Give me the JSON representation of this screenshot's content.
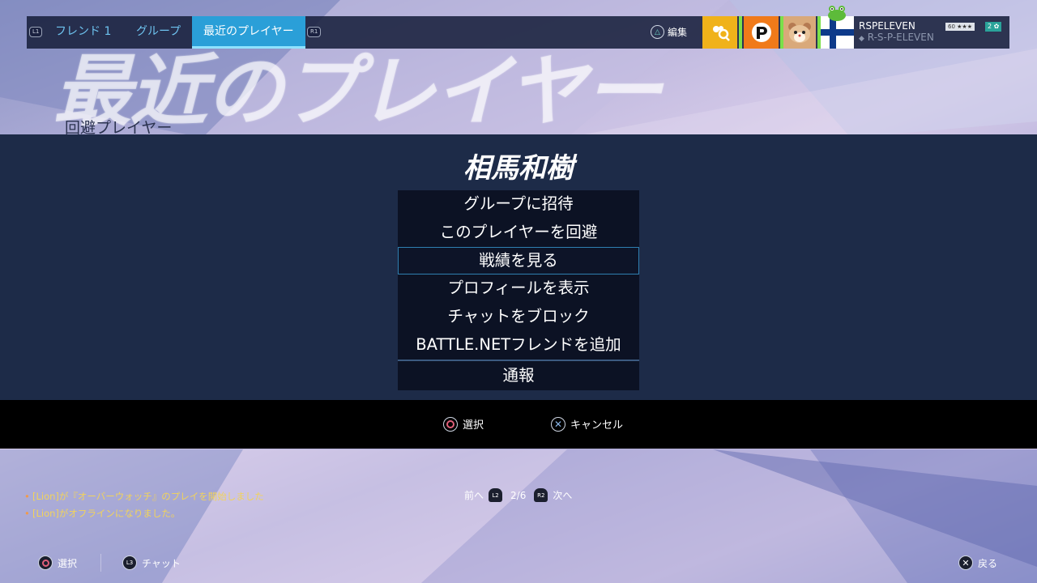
{
  "nav": {
    "l1_tag": "L1",
    "r1_tag": "R1",
    "tabs": [
      {
        "label": "フレンド 1"
      },
      {
        "label": "グループ"
      },
      {
        "label": "最近のプレイヤー"
      }
    ],
    "edit_label": "編集",
    "edit_icon": "triangle-icon"
  },
  "profile": {
    "name": "RSPELEVEN",
    "psn_id": "R-S-P-ELEVEN",
    "level": "60",
    "level_stars": "★★★",
    "rank": "2"
  },
  "page": {
    "big_title": "最近のプレイヤー",
    "subtitle": "回避プレイヤー"
  },
  "modal": {
    "player_name": "相馬和樹",
    "menu_items": [
      {
        "label": "グループに招待"
      },
      {
        "label": "このプレイヤーを回避"
      },
      {
        "label": "戦績を見る"
      },
      {
        "label": "プロフィールを表示"
      },
      {
        "label": "チャットをブロック"
      },
      {
        "label": "BATTLE.NETフレンドを追加"
      },
      {
        "label": "通報"
      }
    ],
    "selected_index": 2
  },
  "actions": {
    "select_label": "選択",
    "cancel_label": "キャンセル"
  },
  "notifications": [
    {
      "text": "[Lion]が『オーバーウォッチ』のプレイを開始しました"
    },
    {
      "text": "[Lion]がオフラインになりました。"
    }
  ],
  "pager": {
    "prev_label": "前へ",
    "l2_tag": "L2",
    "page": "2/6",
    "r2_tag": "R2",
    "next_label": "次へ"
  },
  "footer": {
    "select_label": "選択",
    "l3_tag": "L3",
    "chat_label": "チャット",
    "back_label": "戻る"
  },
  "colors": {
    "accent": "#2a9fd8",
    "modal_bg": "#1d2b48",
    "notification_text": "#f2d35a"
  }
}
